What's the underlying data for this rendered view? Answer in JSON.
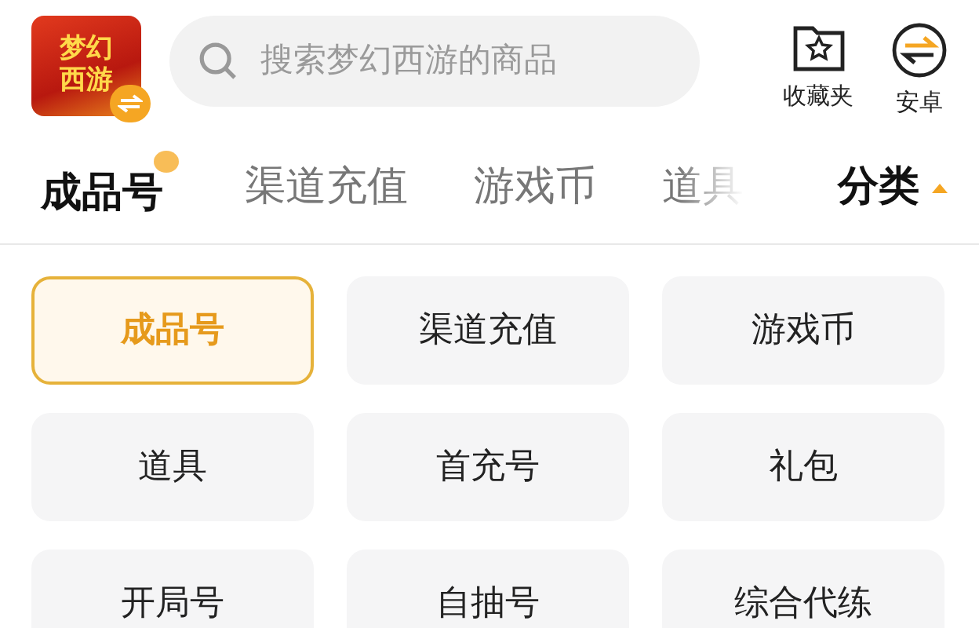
{
  "app_logo": {
    "lines": [
      "梦幻",
      "西游"
    ]
  },
  "search": {
    "placeholder": "搜索梦幻西游的商品"
  },
  "header_actions": [
    {
      "kind": "favorites",
      "label": "收藏夹"
    },
    {
      "kind": "android",
      "label": "安卓"
    }
  ],
  "tabs": [
    {
      "label": "成品号",
      "selected": true
    },
    {
      "label": "渠道充值",
      "selected": false
    },
    {
      "label": "游戏币",
      "selected": false
    },
    {
      "label": "道具",
      "selected": false
    }
  ],
  "category_toggle": {
    "label": "分类",
    "expanded": true
  },
  "categories": [
    {
      "label": "成品号",
      "selected": true
    },
    {
      "label": "渠道充值",
      "selected": false
    },
    {
      "label": "游戏币",
      "selected": false
    },
    {
      "label": "道具",
      "selected": false
    },
    {
      "label": "首充号",
      "selected": false
    },
    {
      "label": "礼包",
      "selected": false
    },
    {
      "label": "开局号",
      "selected": false
    },
    {
      "label": "自抽号",
      "selected": false
    },
    {
      "label": "综合代练",
      "selected": false
    }
  ]
}
